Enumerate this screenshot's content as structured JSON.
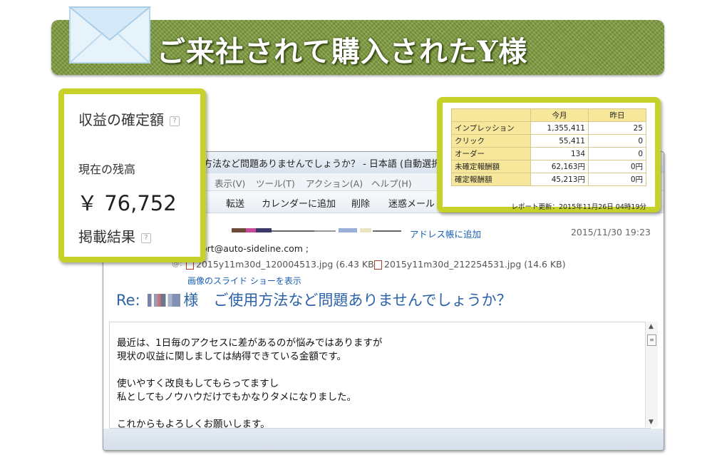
{
  "banner": {
    "title": "ご来社されて購入されたY様"
  },
  "mail": {
    "title": "方法など問題ありませんでしょうか？ - 日本語 (自動選択)",
    "menu": [
      "表示(V)",
      "ツール(T)",
      "アクション(A)",
      "ヘルプ(H)"
    ],
    "toolbar": [
      "転送",
      "カレンダーに追加",
      "削除",
      "迷惑メール"
    ],
    "add_to_address_book": "アドレス帳に追加",
    "date": "2015/11/30 19:23",
    "to": "ort@auto-sideline.com ;",
    "attachments": [
      {
        "name": "2015y11m30d_120004513.jpg (6.43 KB)"
      },
      {
        "name": "2015y11m30d_212254531.jpg (14.6 KB)"
      }
    ],
    "slideshow_link": "画像のスライド ショーを表示",
    "subject_prefix": "Re:",
    "subject_rest": "様　ご使用方法など問題ありませんでしょうか？",
    "body_lines": [
      "最近は、1日毎のアクセスに差があるのが悩みではありますが",
      "現状の収益に関しましては納得できている金額です。",
      "",
      "使いやすく改良もしてもらってますし",
      "私としてもノウハウだけでもかなりタメになりました。",
      "",
      "これからもよろしくお願いします。"
    ]
  },
  "revenue": {
    "confirmed_label": "収益の確定額",
    "balance_label": "現在の残高",
    "balance_amount": "￥ 76,752",
    "results_label": "掲載結果",
    "help_glyph": "?"
  },
  "stats": {
    "columns": [
      "今月",
      "昨日"
    ],
    "rows": [
      {
        "label": "インプレッション",
        "month": "1,355,411",
        "yesterday": "25"
      },
      {
        "label": "クリック",
        "month": "55,411",
        "yesterday": "0"
      },
      {
        "label": "オーダー",
        "month": "134",
        "yesterday": "0"
      },
      {
        "label": "未確定報酬額",
        "month": "62,163円",
        "yesterday": "0円"
      },
      {
        "label": "確定報酬額",
        "month": "45,213円",
        "yesterday": "0円"
      }
    ],
    "report_updated": "レポート更新：2015年11月26日 04時19分"
  },
  "colors": {
    "accent": "#c6d22a",
    "banner": "#7c9a3c",
    "link": "#1a5fb4",
    "table_header": "#f7e79b"
  },
  "icons": [
    "envelope-icon",
    "attachment-icon",
    "help-icon",
    "scroll-up-icon",
    "scroll-down-icon"
  ]
}
